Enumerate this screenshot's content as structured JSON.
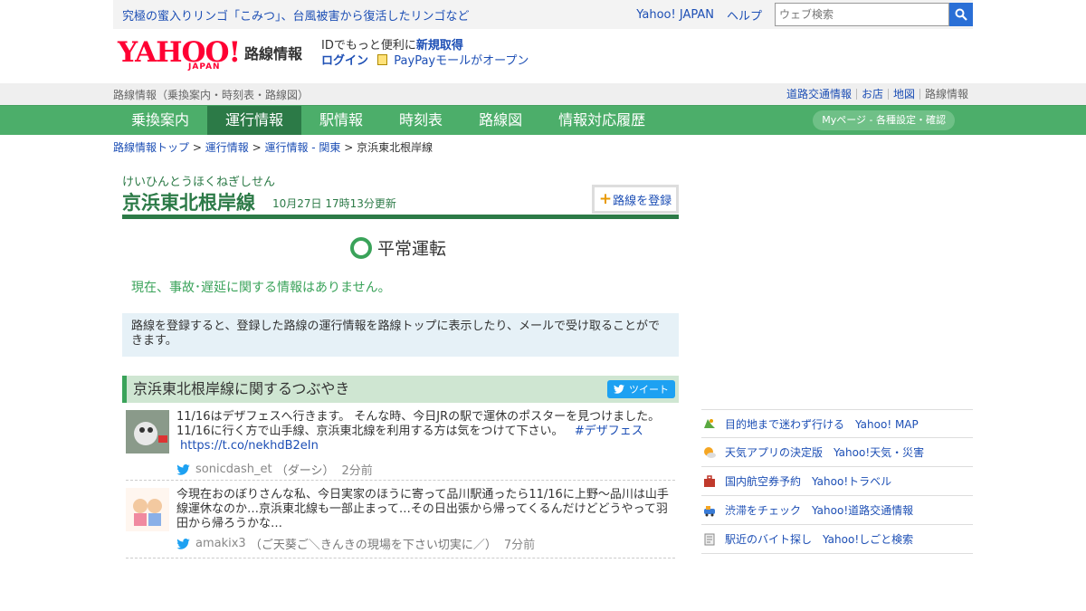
{
  "topbar": {
    "promo": "究極の蜜入りリンゴ「こみつ」、台風被害から復活したリンゴなど",
    "yahoo_japan": "Yahoo! JAPAN",
    "help": "ヘルプ",
    "search_placeholder": "ウェブ検索"
  },
  "header": {
    "logo_yahoo": "YAHOO!",
    "logo_japan": "JAPAN",
    "service": "路線情報",
    "id_prefix": "IDでもっと便利に",
    "id_signup": "新規取得",
    "login": "ログイン",
    "paypay": "PayPayモールがオープン"
  },
  "subbar": {
    "left": "路線情報（乗換案内・時刻表・路線図）",
    "links": [
      "道路交通情報",
      "お店",
      "地図",
      "路線情報"
    ]
  },
  "nav": {
    "tabs": [
      "乗換案内",
      "運行情報",
      "駅情報",
      "時刻表",
      "路線図",
      "情報対応履歴"
    ],
    "active_index": 1,
    "mypage": "Myページ - 各種設定・確認"
  },
  "breadcrumb": {
    "items": [
      "路線情報トップ",
      "運行情報",
      "運行情報 - 関東"
    ],
    "sep": ">",
    "current": "京浜東北根岸線"
  },
  "line": {
    "ruby": "けいひんとうほくねぎしせん",
    "name": "京浜東北根岸線",
    "updated": "10月27日 17時13分更新",
    "register_label": "路線を登録",
    "status": "平常運転",
    "no_info": "現在、事故･遅延に関する情報はありません。",
    "register_info": "路線を登録すると、登録した路線の運行情報を路線トップに表示したり、メールで受け取ることができます。"
  },
  "tweets": {
    "heading": "京浜東北根岸線に関するつぶやき",
    "tweet_button": "ツイート",
    "items": [
      {
        "text": "11/16はデザフェスへ行きます。 そんな時、今日JRの駅で運休のポスターを見つけました。11/16に行く方で山手線、京浜東北線を利用する方は気をつけて下さい。",
        "hashtag": "#デザフェス",
        "url": "https://t.co/nekhdB2eIn",
        "user": "sonicdash_et",
        "display": "（ダーシ）",
        "ago": "2分前"
      },
      {
        "text": "今現在おのぼりさんな私、今日実家のほうに寄って品川駅通ったら11/16に上野～品川は山手線運休なのか…京浜東北線も一部止まって…その日出張から帰ってくるんだけどどうやって羽田から帰ろうかな…",
        "user": "amakix3",
        "display": "（ご天葵ご＼きんきの現場を下さい切実に／）",
        "ago": "7分前"
      }
    ]
  },
  "side": {
    "items": [
      {
        "text": "目的地まで迷わず行ける　Yahoo! MAP",
        "icon": "map-icon"
      },
      {
        "text": "天気アプリの決定版　Yahoo!天気・災害",
        "icon": "weather-icon"
      },
      {
        "text": "国内航空券予約　Yahoo!トラベル",
        "icon": "suitcase-icon"
      },
      {
        "text": "渋滞をチェック　Yahoo!道路交通情報",
        "icon": "car-icon"
      },
      {
        "text": "駅近のバイト探し　Yahoo!しごと検索",
        "icon": "job-icon"
      }
    ]
  },
  "colors": {
    "nav_green": "#4cae6a",
    "nav_active": "#2c7a47",
    "status_green": "#3aa35a",
    "link_blue": "#1d4fb5",
    "yahoo_red": "#ff0033"
  }
}
